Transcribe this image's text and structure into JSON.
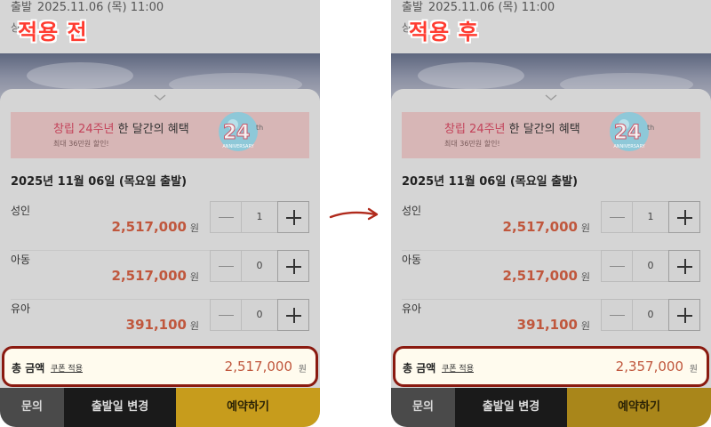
{
  "panels": [
    {
      "tag": "적용 전",
      "status": {
        "type": "출발",
        "date": "2025.11.06 (목) 11:00",
        "sub": "상"
      },
      "banner": {
        "highlight": "창립 24주년",
        "rest": " 한 달간의 혜택",
        "sub": "최대 36만원 할인!",
        "badge_number": "24",
        "badge_sup": "th",
        "badge_word": "ANNIVERSARY"
      },
      "departure": "2025년 11월 06일 (목요일 출발)",
      "rows": [
        {
          "label": "성인",
          "price": "2,517,000",
          "unit": "원",
          "qty": "1"
        },
        {
          "label": "아동",
          "price": "2,517,000",
          "unit": "원",
          "qty": "0"
        },
        {
          "label": "유아",
          "price": "391,100",
          "unit": "원",
          "qty": "0"
        }
      ],
      "total": {
        "label": "총 금액",
        "coupon": "쿠폰 적용",
        "amount": "2,517,000",
        "unit": "원"
      },
      "buttons": {
        "inquiry": "문의",
        "change_date": "출발일 변경",
        "reserve": "예약하기"
      }
    },
    {
      "tag": "적용 후",
      "status": {
        "type": "출발",
        "date": "2025.11.06 (목) 11:00",
        "sub": "상"
      },
      "banner": {
        "highlight": "창립 24주년",
        "rest": " 한 달간의 혜택",
        "sub": "최대 36만원 할인!",
        "badge_number": "24",
        "badge_sup": "th",
        "badge_word": "ANNIVERSARY"
      },
      "departure": "2025년 11월 06일 (목요일 출발)",
      "rows": [
        {
          "label": "성인",
          "price": "2,517,000",
          "unit": "원",
          "qty": "1"
        },
        {
          "label": "아동",
          "price": "2,517,000",
          "unit": "원",
          "qty": "0"
        },
        {
          "label": "유아",
          "price": "391,100",
          "unit": "원",
          "qty": "0"
        }
      ],
      "total": {
        "label": "총 금액",
        "coupon": "쿠폰 적용",
        "amount": "2,357,000",
        "unit": "원"
      },
      "buttons": {
        "inquiry": "문의",
        "change_date": "출발일 변경",
        "reserve": "예약하기"
      }
    }
  ],
  "colors": {
    "tag": "#ff3b30",
    "price": "#c0573d",
    "highlight_border": "#8a1a10",
    "reserve_button": "#c79c1c",
    "arrow": "#b02a1c"
  },
  "icons": {
    "transition": "arrow-right-icon",
    "handle": "chevron-down-icon",
    "minus": "minus-icon",
    "plus": "plus-icon"
  }
}
